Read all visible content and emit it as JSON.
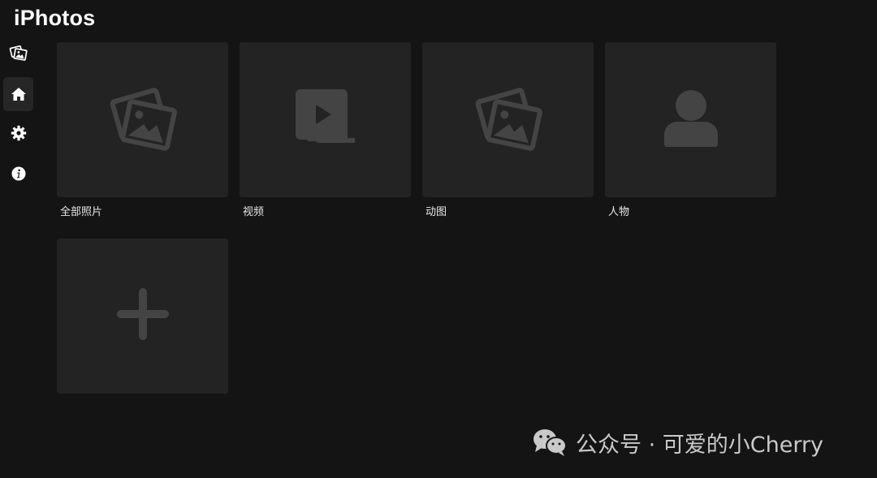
{
  "app": {
    "title": "iPhotos"
  },
  "sidebar": {
    "items": [
      {
        "icon": "photos-icon",
        "active": false
      },
      {
        "icon": "home-icon",
        "active": true
      },
      {
        "icon": "gear-icon",
        "active": false
      },
      {
        "icon": "info-icon",
        "active": false
      }
    ]
  },
  "albums": [
    {
      "label": "全部照片",
      "icon": "photos-icon"
    },
    {
      "label": "视频",
      "icon": "video-icon"
    },
    {
      "label": "动图",
      "icon": "photos-icon"
    },
    {
      "label": "人物",
      "icon": "person-icon"
    }
  ],
  "add_tile": {
    "icon": "plus-icon"
  },
  "watermark": {
    "text": "公众号 · 可爱的小Cherry"
  },
  "colors": {
    "background": "#141414",
    "tile": "#232323",
    "icon": "#444444",
    "text": "#ffffff"
  }
}
